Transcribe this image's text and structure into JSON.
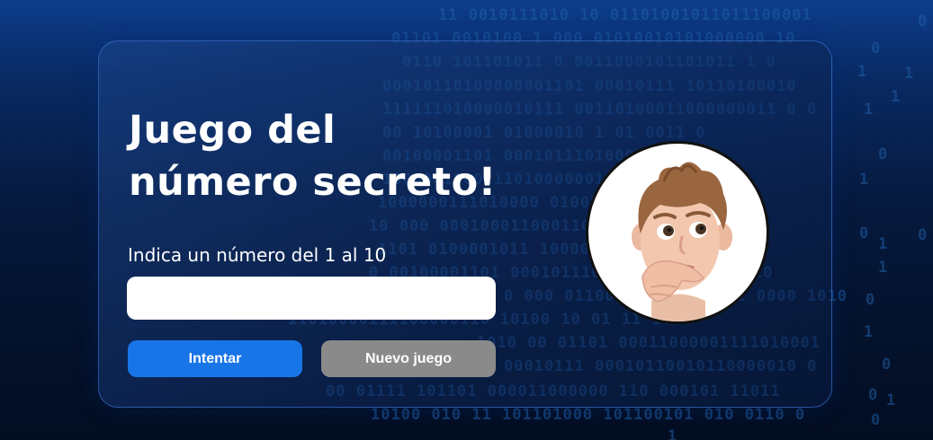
{
  "background": {
    "binary_lines": [
      "11 0010111010 10 01101001011011100001",
      "01101 0010100 1   000 01010010101000000 10",
      "0110 101101011 0   0011000101101011 1 0",
      "00010110100000001101 00010111 10110100010",
      "111111010000010111 00110100011000000011 0 0",
      "00 10100001 01000010  1 01 0011 0",
      "00100001101 00010111010001101 0 0",
      "100000100011101000000110 01011101",
      "1000000111010000 01001010 0 100011 00",
      "10 000 000100011000110 10010 0 0",
      "1101 0100001011 10000 10000110 00000",
      "0 00100001101 00010111010001101 01000110",
      "0 000 0110010000110 0101 0000 1010",
      "11010000111100000110 10100 10 01 11 100",
      "1010 00 01101 00011000001111010001",
      "00010111 00010110010110000010 0",
      "00 01111  101101 000011000000 110 000101 11011",
      "10100 010 11 101101000 101100101 010 0110 0"
    ],
    "scattered_digits": [
      "1",
      "0",
      "1",
      "1",
      "0",
      "1",
      "0",
      "1",
      "0",
      "1",
      "1",
      "0",
      "0",
      "1",
      "0",
      "1",
      "0",
      "1",
      "0"
    ]
  },
  "game": {
    "title_line1": "Juego del",
    "title_line2": "número secreto!",
    "prompt": "Indica un número del 1 al 10",
    "input_value": "",
    "try_button": "Intentar",
    "new_game_button": "Nuevo juego"
  },
  "avatar": {
    "icon": "thinking-boy-memoji"
  },
  "colors": {
    "title": "#ffffff",
    "try_button": "#1875e8",
    "new_game_button": "#8a8a8a",
    "input_background": "#ffffff",
    "binary_digits": "#1e5fa8"
  }
}
